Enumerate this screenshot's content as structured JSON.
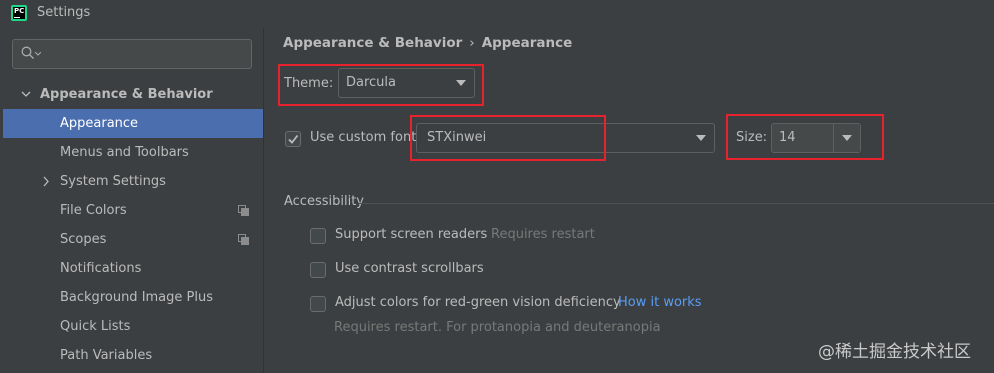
{
  "window": {
    "title": "Settings",
    "app_icon_text": "PC"
  },
  "search": {
    "placeholder": ""
  },
  "sidebar": {
    "items": [
      {
        "label": "Appearance & Behavior",
        "expanded": true
      },
      {
        "label": "Appearance",
        "selected": true
      },
      {
        "label": "Menus and Toolbars"
      },
      {
        "label": "System Settings",
        "expandable": true
      },
      {
        "label": "File Colors",
        "icon": "copy-icon"
      },
      {
        "label": "Scopes",
        "icon": "copy-icon"
      },
      {
        "label": "Notifications"
      },
      {
        "label": "Background Image Plus"
      },
      {
        "label": "Quick Lists"
      },
      {
        "label": "Path Variables"
      }
    ]
  },
  "breadcrumb": {
    "parent": "Appearance & Behavior",
    "separator": "›",
    "current": "Appearance"
  },
  "theme": {
    "label": "Theme:",
    "value": "Darcula"
  },
  "custom_font": {
    "label": "Use custom font:",
    "checked": true,
    "value": "STXinwei"
  },
  "size": {
    "label": "Size:",
    "value": "14"
  },
  "accessibility": {
    "title": "Accessibility",
    "screen_readers": {
      "label": "Support screen readers",
      "hint": "Requires restart",
      "checked": false
    },
    "contrast_scrollbars": {
      "label": "Use contrast scrollbars",
      "checked": false
    },
    "color_deficiency": {
      "label": "Adjust colors for red-green vision deficiency",
      "link": "How it works",
      "hint": "Requires restart. For protanopia and deuteranopia",
      "checked": false
    }
  },
  "watermark": "@稀土掘金技术社区",
  "colors": {
    "background": "#3c3f41",
    "selection": "#4b6eaf",
    "link": "#589df6",
    "highlight_box": "#e8222d"
  }
}
